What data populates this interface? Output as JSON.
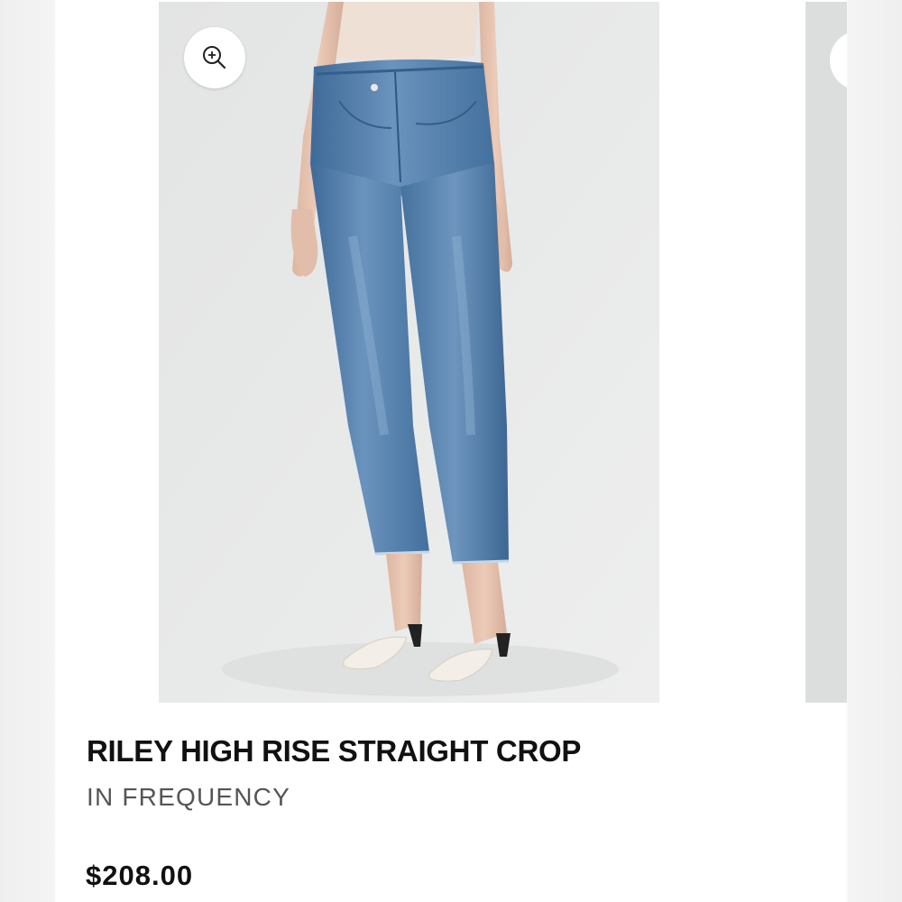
{
  "product": {
    "title": "RILEY HIGH RISE STRAIGHT CROP",
    "brand": "IN FREQUENCY",
    "price": "$208.00"
  },
  "gallery": {
    "zoom_icon": "zoom-in-icon",
    "image_subject": "model-wearing-jeans"
  },
  "colors": {
    "background": "#ffffff",
    "side_gutter": "#f1f1f1",
    "photo_backdrop": "#e6e7e7",
    "denim": "#4f7aa8",
    "text_primary": "#111111",
    "text_secondary": "#555555"
  }
}
